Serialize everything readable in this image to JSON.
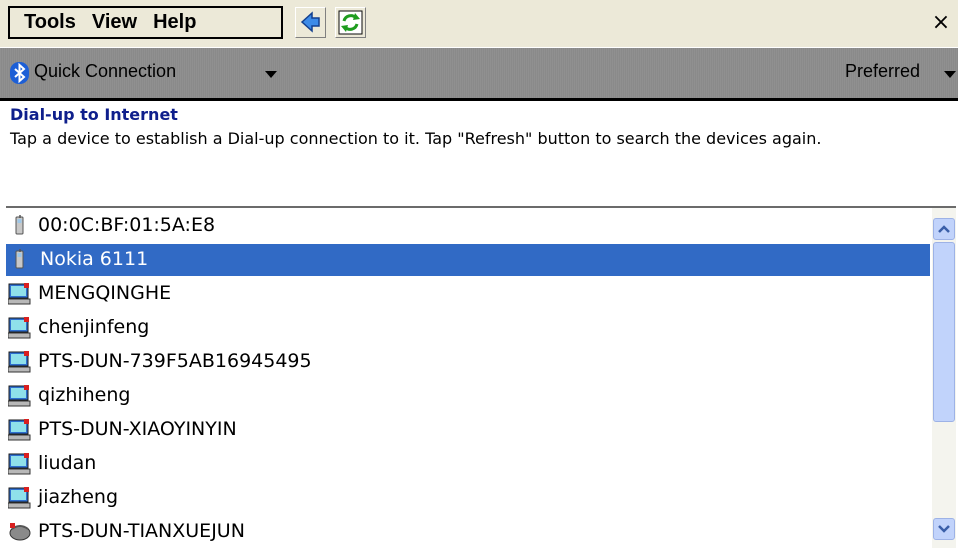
{
  "menu": {
    "items": [
      "Tools",
      "View",
      "Help"
    ],
    "back_icon": "back-arrow-icon",
    "refresh_icon": "refresh-icon",
    "close_label": "×"
  },
  "header": {
    "title": "Quick Connection",
    "right_label": "Preferred",
    "icon": "bluetooth-icon"
  },
  "section": {
    "title": "Dial-up to Internet",
    "description": "Tap a device to establish a Dial-up connection to it. Tap \"Refresh\" button to search the devices again."
  },
  "devices": [
    {
      "name": "00:0C:BF:01:5A:E8",
      "icon": "phone-icon"
    },
    {
      "name": "Nokia 6111",
      "icon": "phone-icon",
      "selected": true
    },
    {
      "name": "MENGQINGHE",
      "icon": "computer-icon"
    },
    {
      "name": "chenjinfeng",
      "icon": "computer-icon"
    },
    {
      "name": "PTS-DUN-739F5AB16945495",
      "icon": "computer-icon"
    },
    {
      "name": "qizhiheng",
      "icon": "computer-icon"
    },
    {
      "name": "PTS-DUN-XIAOYINYIN",
      "icon": "computer-icon"
    },
    {
      "name": "liudan",
      "icon": "computer-icon"
    },
    {
      "name": "jiazheng",
      "icon": "computer-icon"
    },
    {
      "name": "PTS-DUN-TIANXUEJUN",
      "icon": "device-icon"
    }
  ],
  "colors": {
    "selection": "#316ac5",
    "section_title": "#0f1f8c",
    "header_bar": "#8d8d8d"
  }
}
